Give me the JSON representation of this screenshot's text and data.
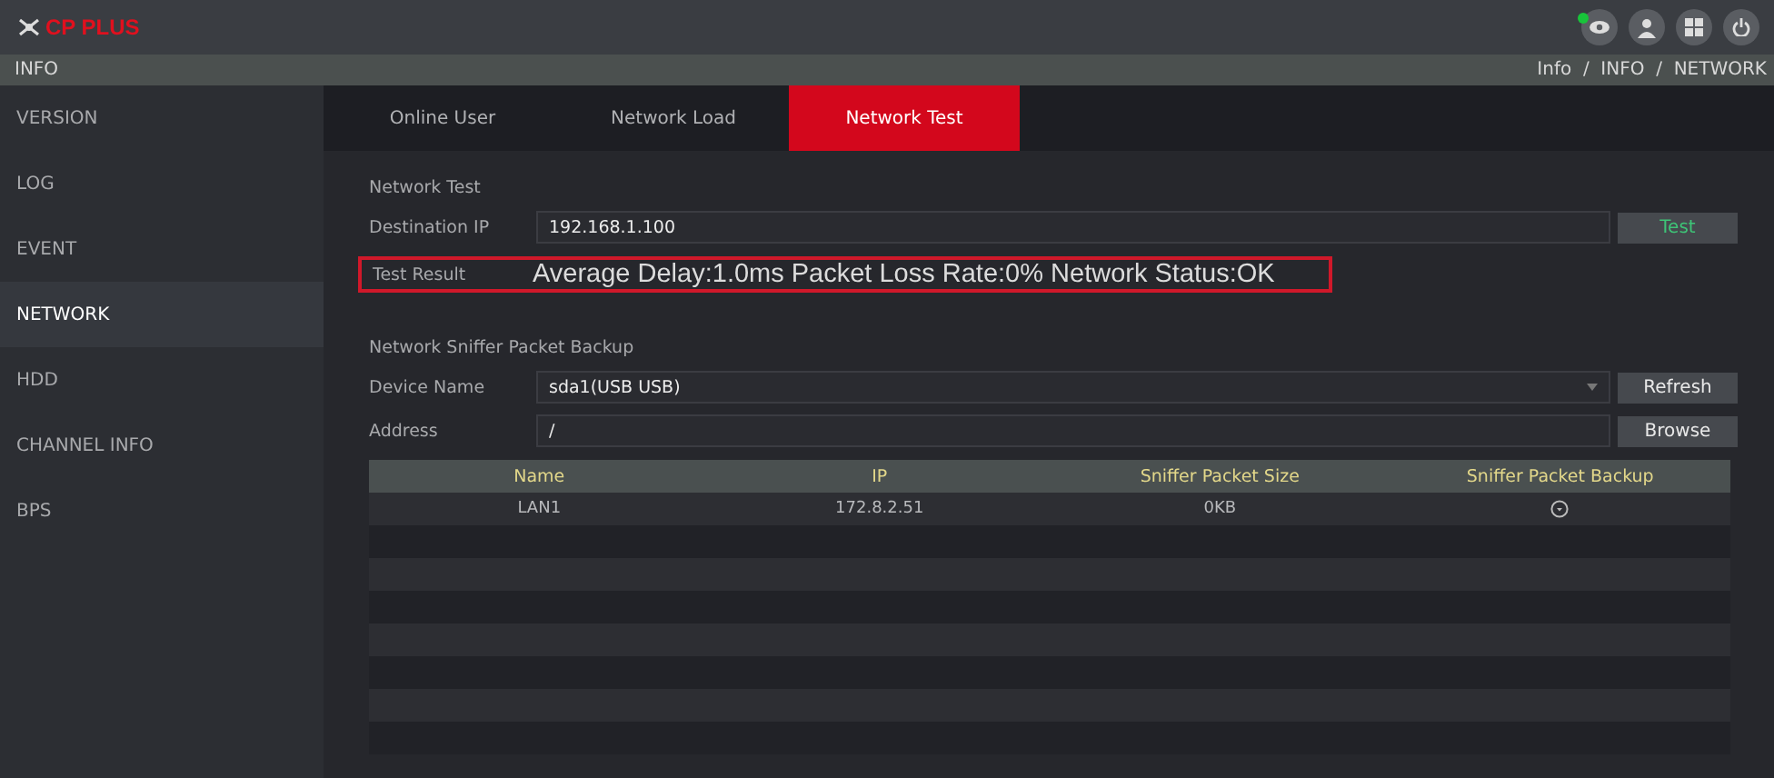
{
  "header": {
    "logo": "CP PLUS"
  },
  "breadcrumb_bar": {
    "title": "INFO",
    "path": "Info  /  INFO  /  NETWORK"
  },
  "sidebar": {
    "items": [
      {
        "label": "VERSION",
        "selected": false
      },
      {
        "label": "LOG",
        "selected": false
      },
      {
        "label": "EVENT",
        "selected": false
      },
      {
        "label": "NETWORK",
        "selected": true
      },
      {
        "label": "HDD",
        "selected": false
      },
      {
        "label": "CHANNEL INFO",
        "selected": false
      },
      {
        "label": "BPS",
        "selected": false
      }
    ]
  },
  "tabs": [
    {
      "label": "Online User",
      "selected": false
    },
    {
      "label": "Network Load",
      "selected": false
    },
    {
      "label": "Network Test",
      "selected": true
    }
  ],
  "network_test": {
    "title": "Network Test",
    "destination_label": "Destination IP",
    "destination_value": "192.168.1.100",
    "test_button": "Test",
    "result_label": "Test Result",
    "result": "Average Delay:1.0ms  Packet Loss Rate:0%  Network Status:OK"
  },
  "sniffer": {
    "title": "Network Sniffer Packet Backup",
    "device_label": "Device Name",
    "device_value": "sda1(USB USB)",
    "refresh_button": "Refresh",
    "address_label": "Address",
    "address_value": "/",
    "browse_button": "Browse"
  },
  "table": {
    "columns": [
      "Name",
      "IP",
      "Sniffer Packet Size",
      "Sniffer Packet Backup"
    ],
    "rows": [
      {
        "name": "LAN1",
        "ip": "172.8.2.51",
        "size": "0KB"
      }
    ]
  }
}
